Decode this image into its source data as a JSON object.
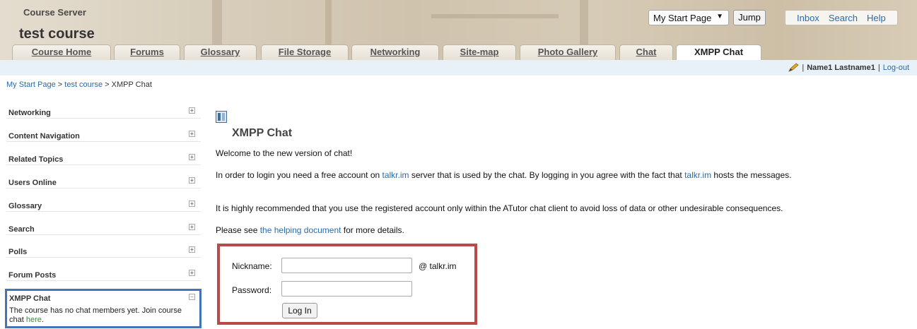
{
  "header": {
    "site_name": "Course Server",
    "course_title": "test course",
    "start_select": {
      "selected": "My Start Page"
    },
    "jump_label": "Jump",
    "top_links": [
      "Inbox",
      "Search",
      "Help"
    ]
  },
  "tabs": [
    {
      "label": "Course Home",
      "active": false
    },
    {
      "label": "Forums",
      "active": false
    },
    {
      "label": "Glossary",
      "active": false
    },
    {
      "label": "File Storage",
      "active": false
    },
    {
      "label": "Networking",
      "active": false
    },
    {
      "label": "Site-map",
      "active": false
    },
    {
      "label": "Photo Gallery",
      "active": false
    },
    {
      "label": "Chat",
      "active": false
    },
    {
      "label": "XMPP Chat",
      "active": true
    }
  ],
  "user_bar": {
    "sep1": "|",
    "user_name": "Name1 Lastname1",
    "sep2": "|",
    "logout": "Log-out",
    "icon": "pencil-icon"
  },
  "breadcrumb": {
    "items": [
      "My Start Page",
      "test course"
    ],
    "sep": ">",
    "current": "XMPP Chat"
  },
  "side_menu": {
    "items": [
      {
        "label": "Networking",
        "toggle": "+"
      },
      {
        "label": "Content Navigation",
        "toggle": "+"
      },
      {
        "label": "Related Topics",
        "toggle": "+"
      },
      {
        "label": "Users Online",
        "toggle": "+"
      },
      {
        "label": "Glossary",
        "toggle": "+"
      },
      {
        "label": "Search",
        "toggle": "+"
      },
      {
        "label": "Polls",
        "toggle": "+"
      },
      {
        "label": "Forum Posts",
        "toggle": "+"
      }
    ],
    "xmpp_panel": {
      "title": "XMPP Chat",
      "toggle": "−",
      "text": "The course has no chat members yet. Join course chat ",
      "link": "here",
      "end": "."
    }
  },
  "content": {
    "title": "XMPP Chat",
    "welcome": "Welcome to the new version of chat!",
    "p1_a": "In order to login you need a free account on ",
    "p1_link1": "talkr.im",
    "p1_b": " server that is used by the chat. By logging in you agree with the fact that ",
    "p1_link2": "talkr.im",
    "p1_c": " hosts the messages.",
    "p2": "It is highly recommended that you use the registered account only within the ATutor chat client to avoid loss of data or other undesirable consequences.",
    "p3_a": "Please see ",
    "p3_link": "the helping document",
    "p3_b": " for more details.",
    "login": {
      "nickname_label": "Nickname:",
      "nickname_value": "",
      "domain_suffix": "@ talkr.im",
      "password_label": "Password:",
      "password_value": "",
      "button": "Log In"
    }
  },
  "colors": {
    "link": "#2a6aa8",
    "login_box_border": "#b84a4a",
    "xmpp_panel_border": "#4473b6",
    "user_bar_bg": "#e8f1f7"
  }
}
